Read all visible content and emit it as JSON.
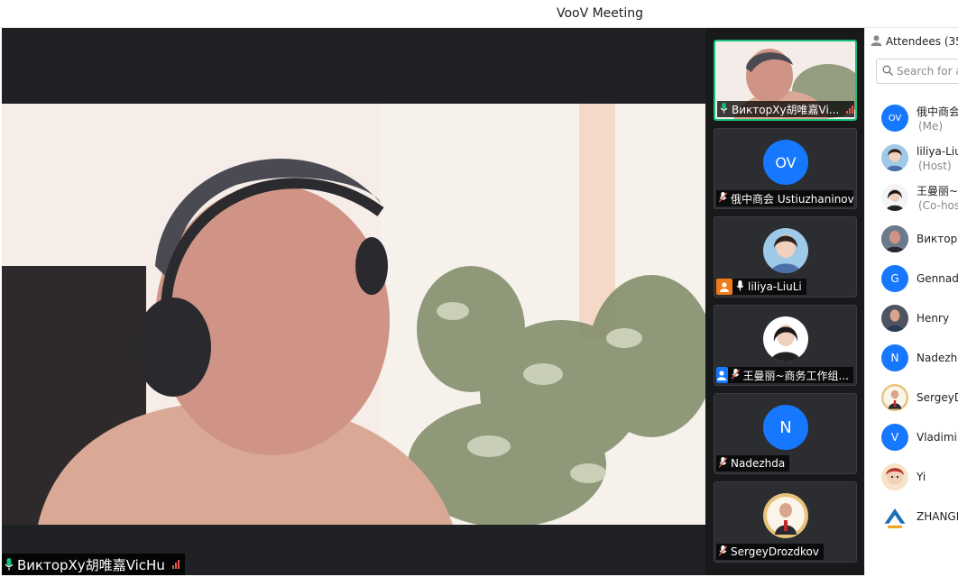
{
  "window": {
    "title": "VooV Meeting"
  },
  "main_video": {
    "speaker_name": "ВикторXу胡唯嘉VicHu",
    "accent": "#17c37b"
  },
  "strip": {
    "tiles": [
      {
        "name": "ВикторXу胡唯嘉Vi...",
        "mic": "on",
        "active": true
      },
      {
        "name": "俄中商会 Ustiuzhaninov",
        "initials": "OV",
        "mic": "muted"
      },
      {
        "name": "liliya-LiuLi",
        "mic": "on",
        "host_badge": true
      },
      {
        "name": "王曼丽~商务工作组...",
        "mic": "muted",
        "cohost_badge": true
      },
      {
        "name": "Nadezhda",
        "initials": "N",
        "mic": "muted"
      },
      {
        "name": "SergeyDrozdkov",
        "mic": "muted"
      }
    ]
  },
  "panel": {
    "header": "Attendees (35",
    "search_placeholder": "Search for a",
    "attendees": [
      {
        "name": "俄中商会",
        "role": "(Me)",
        "initials": "OV"
      },
      {
        "name": "liliya-Liu",
        "role": "(Host)"
      },
      {
        "name": "王曼丽~",
        "role": "(Co-hos"
      },
      {
        "name": "ВикторХ"
      },
      {
        "name": "Gennady",
        "initials": "G"
      },
      {
        "name": "Henry"
      },
      {
        "name": "Nadezhd",
        "initials": "N"
      },
      {
        "name": "SergeyD"
      },
      {
        "name": "Vladimir",
        "initials": "V"
      },
      {
        "name": "Yi"
      },
      {
        "name": "ZHANGL"
      }
    ]
  },
  "colors": {
    "blue": "#1677ff",
    "green": "#17c37b",
    "red": "#e0594a",
    "orange": "#f07a1a"
  }
}
